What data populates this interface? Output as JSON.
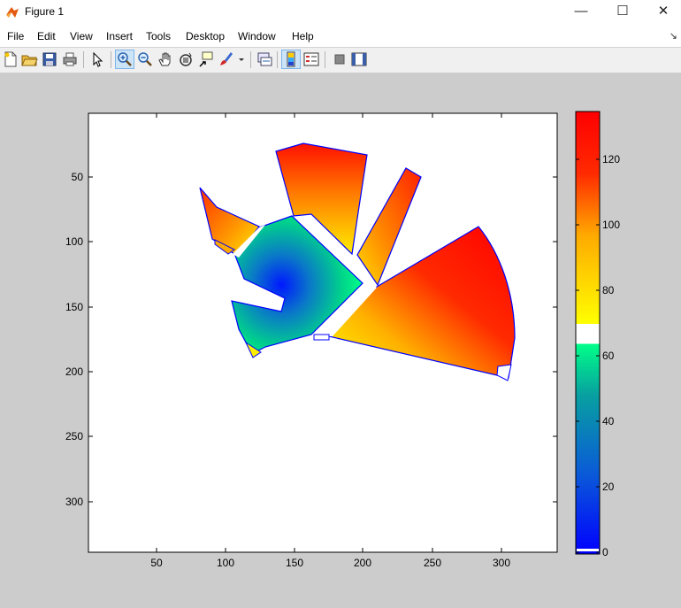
{
  "window": {
    "title": "Figure 1",
    "minimize_glyph": "—",
    "maximize_glyph": "☐",
    "close_glyph": "✕"
  },
  "menubar": {
    "items": [
      "File",
      "Edit",
      "View",
      "Insert",
      "Tools",
      "Desktop",
      "Window",
      "Help"
    ],
    "overflow_glyph": "↘"
  },
  "toolbar": {
    "buttons": [
      {
        "name": "new-figure-icon"
      },
      {
        "name": "open-file-icon"
      },
      {
        "name": "save-figure-icon"
      },
      {
        "name": "print-figure-icon"
      },
      {
        "name": "edit-plot-arrow-icon"
      },
      {
        "name": "zoom-in-icon",
        "active": true
      },
      {
        "name": "zoom-out-icon"
      },
      {
        "name": "pan-hand-icon"
      },
      {
        "name": "rotate-3d-icon"
      },
      {
        "name": "data-cursor-icon"
      },
      {
        "name": "brush-icon"
      },
      {
        "name": "link-plot-icon"
      },
      {
        "name": "insert-colorbar-icon",
        "active": true
      },
      {
        "name": "insert-legend-icon"
      },
      {
        "name": "hide-plot-tools-icon"
      },
      {
        "name": "show-plot-tools-icon"
      }
    ]
  },
  "axes": {
    "x_ticks": [
      "50",
      "100",
      "150",
      "200",
      "250",
      "300"
    ],
    "y_ticks": [
      "50",
      "100",
      "150",
      "200",
      "250",
      "300"
    ]
  },
  "colorbar": {
    "ticks": [
      "0",
      "20",
      "40",
      "60",
      "80",
      "100",
      "120"
    ],
    "colormap_colors": [
      "#0000ff",
      "#0a6cc8",
      "#00ff88",
      "#ffffff",
      "#ffff00",
      "#ff9900",
      "#ff0000"
    ]
  }
}
